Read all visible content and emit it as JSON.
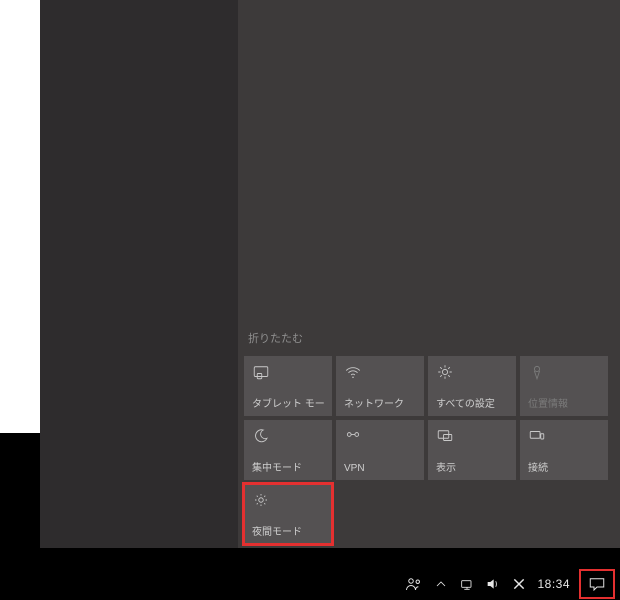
{
  "actionCenter": {
    "collapse_label": "折りたたむ",
    "tiles": [
      {
        "label": "タブレット モード",
        "icon": "tablet-icon"
      },
      {
        "label": "ネットワーク",
        "icon": "wifi-icon"
      },
      {
        "label": "すべての設定",
        "icon": "gear-icon"
      },
      {
        "label": "位置情報",
        "icon": "location-icon",
        "disabled": true
      },
      {
        "label": "集中モード",
        "icon": "moon-icon"
      },
      {
        "label": "VPN",
        "icon": "vpn-icon"
      },
      {
        "label": "表示",
        "icon": "project-icon"
      },
      {
        "label": "接続",
        "icon": "connect-icon"
      },
      {
        "label": "夜間モード",
        "icon": "night-light-icon",
        "highlight": true
      }
    ]
  },
  "taskbar": {
    "clock": "18:34"
  },
  "highlight_color": "#e43030"
}
